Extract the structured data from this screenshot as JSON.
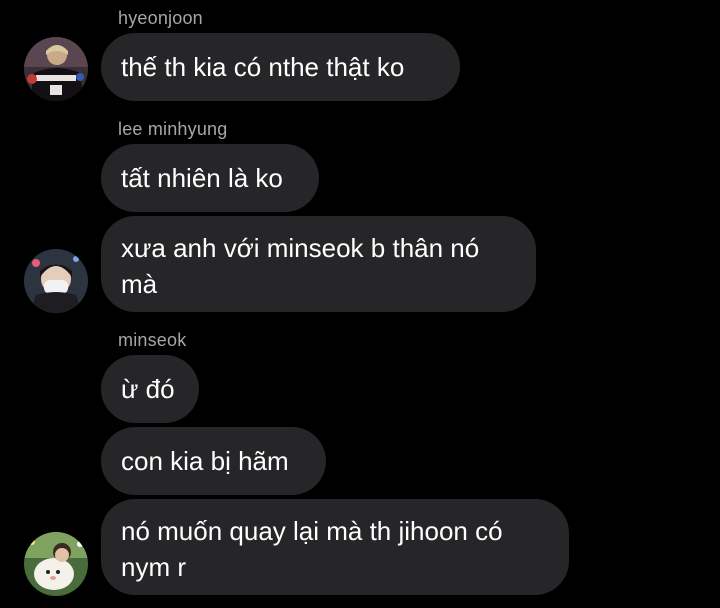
{
  "chat": {
    "groups": [
      {
        "sender": "hyeonjoon",
        "messages": [
          "thế th kia có nthe thật ko"
        ],
        "avatar_icon": "user-avatar-icon"
      },
      {
        "sender": "lee minhyung",
        "messages": [
          "tất nhiên là ko",
          "xưa anh với minseok b thân nó mà"
        ],
        "avatar_icon": "user-avatar-icon"
      },
      {
        "sender": "minseok",
        "messages": [
          "ừ đó",
          "con kia bị hãm",
          "nó muốn quay lại mà th jihoon có nym r"
        ],
        "avatar_icon": "user-avatar-icon"
      }
    ]
  },
  "colors": {
    "background": "#000000",
    "bubble": "#262628",
    "sender_name": "#a6a6ab",
    "text": "#ffffff"
  }
}
